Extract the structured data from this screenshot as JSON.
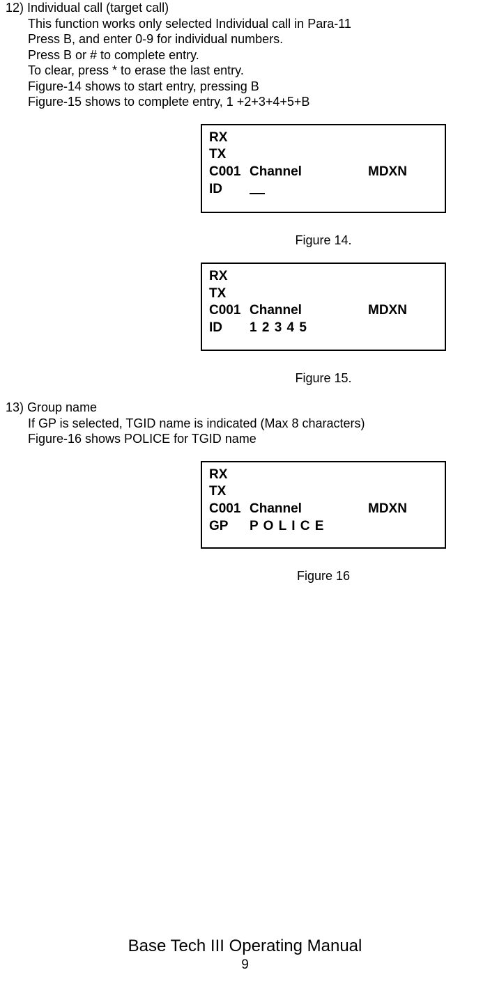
{
  "section12": {
    "heading": "12) Individual call (target call)",
    "lines": [
      "This function works only selected Individual call in Para-11",
      "Press B, and enter 0-9 for individual numbers.",
      "Press B or # to complete entry.",
      "To clear, press * to erase the last entry.",
      "Figure-14 shows to start entry, pressing B",
      "Figure-15 shows to complete entry, 1 +2+3+4+5+B"
    ]
  },
  "fig14": {
    "rx": "RX",
    "tx": "TX",
    "ch": "C001",
    "chName": "Channel",
    "mode": "MDXN",
    "lbl": "ID",
    "val": "",
    "caption": "Figure 14."
  },
  "fig15": {
    "rx": "RX",
    "tx": "TX",
    "ch": "C001",
    "chName": "Channel",
    "mode": "MDXN",
    "lbl": "ID",
    "val": "1 2 3 4 5",
    "caption": "Figure 15."
  },
  "section13": {
    "heading": "13) Group name",
    "lines": [
      "If GP is selected, TGID name is indicated (Max 8 characters)",
      "Figure-16 shows POLICE for TGID name"
    ]
  },
  "fig16": {
    "rx": "RX",
    "tx": "TX",
    "ch": "C001",
    "chName": "Channel",
    "mode": "MDXN",
    "lbl": "GP",
    "val": "P O L I C E",
    "caption": "Figure 16"
  },
  "footer": {
    "title": "Base Tech III Operating Manual",
    "page": "9"
  }
}
